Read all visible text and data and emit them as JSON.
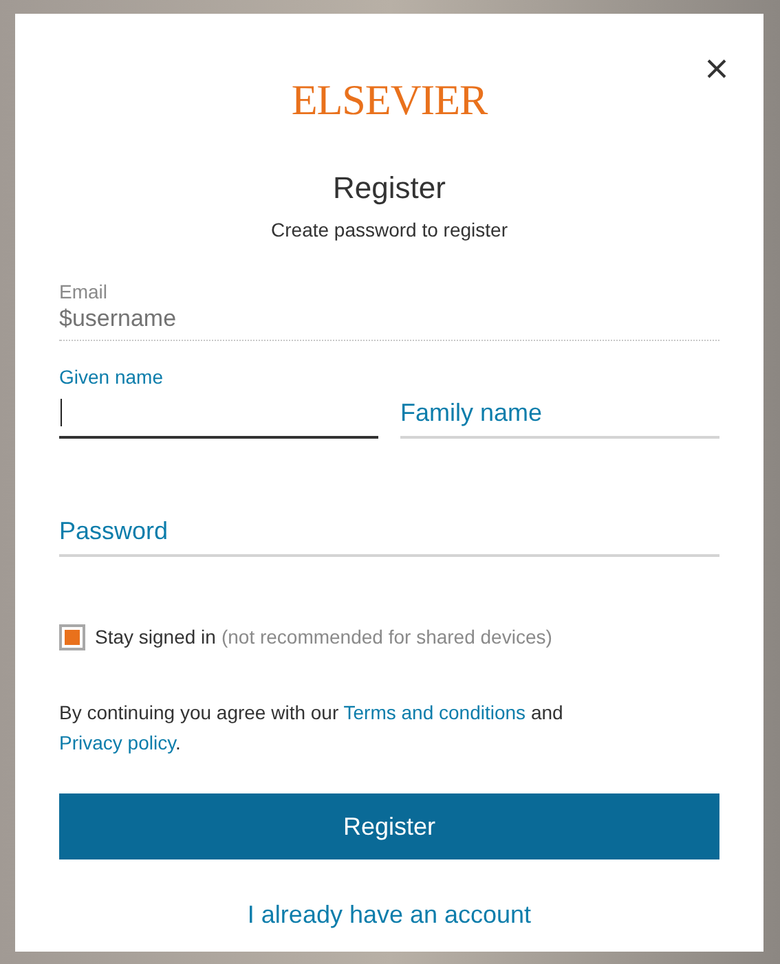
{
  "logo": "ELSEVIER",
  "heading": "Register",
  "subtitle": "Create password to register",
  "email": {
    "kind": "readonly",
    "label": "Email",
    "value": "$username"
  },
  "name_fields": [
    {
      "label": "Given name",
      "focused": true
    },
    {
      "label": "Family name",
      "focused": false
    }
  ],
  "password": {
    "label": "Password",
    "focused": false
  },
  "stay_signed_in": {
    "label": "Stay signed in",
    "note": "(not recommended for shared devices)",
    "checked": true
  },
  "consent": {
    "before": "By continuing you agree with our",
    "terms_link": "Terms and conditions",
    "middle": "and",
    "privacy_link": "Privacy policy",
    "after": "."
  },
  "submit": "Register",
  "account_link": "I already have an account"
}
